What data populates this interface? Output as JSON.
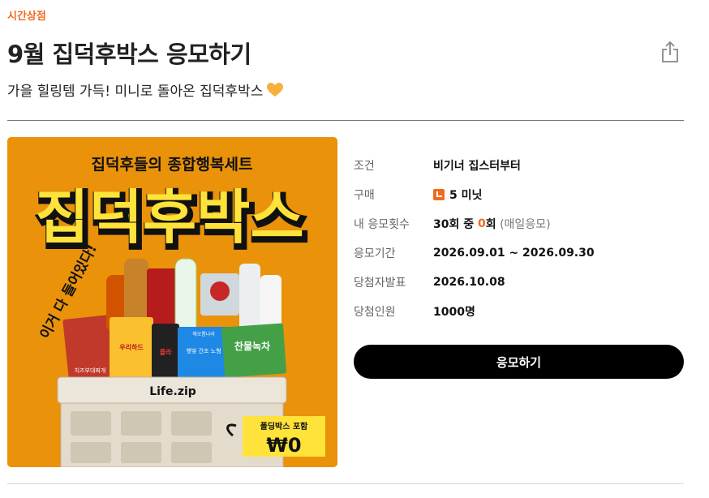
{
  "header": {
    "category": "시간상점",
    "title": "9월 집덕후박스 응모하기",
    "subtitle": "가을 힐링템 가득! 미니로 돌아온 집덕후박스",
    "share_icon": "share-icon",
    "heart_icon": "orange-heart-icon"
  },
  "promo": {
    "headline": "집덕후들의 종합행복세트",
    "brand_title": "집덕후박스",
    "side_text": "이거 다 들어있다!",
    "box_label": "Life.zip",
    "badge_text": "폴딩박스 포함",
    "badge_price": "₩0",
    "product_labels": [
      "치즈부대찌개",
      "우리하드",
      "콜라",
      "찬물녹차",
      "햇빛 건조 노형",
      "해오름나라"
    ]
  },
  "info": {
    "rows": [
      {
        "label": "조건",
        "value": "비기너 집스터부터"
      },
      {
        "label": "구매",
        "value": "5 미닛",
        "icon": "minute-icon"
      },
      {
        "label": "내 응모횟수",
        "value_parts": [
          "30회 중 ",
          "0",
          "회",
          " (매일응모)"
        ]
      },
      {
        "label": "응모기간",
        "value": "2026.09.01 ~ 2026.09.30"
      },
      {
        "label": "당첨자발표",
        "value": "2026.10.08"
      },
      {
        "label": "당첨인원",
        "value": "1000명"
      }
    ]
  },
  "actions": {
    "apply_label": "응모하기"
  },
  "colors": {
    "accent": "#f06b1f",
    "promo_bg": "#e9920a",
    "promo_yellow": "#ffe23a",
    "button_bg": "#000000"
  }
}
